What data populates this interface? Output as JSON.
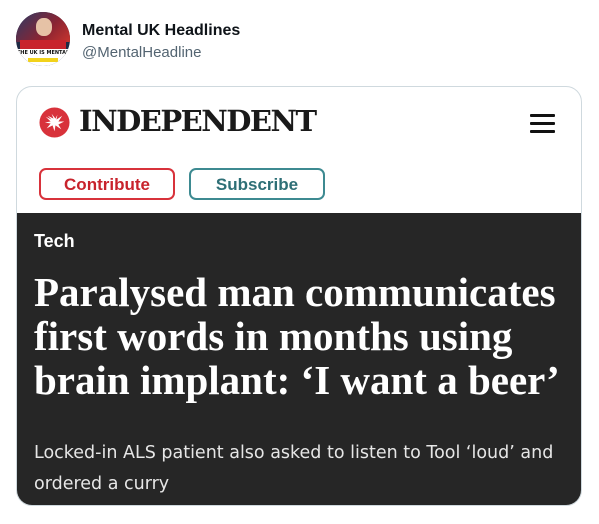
{
  "tweet": {
    "display_name": "Mental UK Headlines",
    "handle": "@MentalHeadline",
    "avatar_caption": "THE UK IS MENTAL"
  },
  "site": {
    "name": "INDEPENDENT",
    "logo_icon": "eagle-icon",
    "menu_icon": "hamburger-menu-icon",
    "brand_color": "#c8232c"
  },
  "actions": {
    "contribute_label": "Contribute",
    "subscribe_label": "Subscribe",
    "contribute_color": "#d8323b",
    "subscribe_color": "#3d8a91"
  },
  "article": {
    "category": "Tech",
    "headline": "Paralysed man communicates first words in months using brain implant: ‘I want a beer’",
    "subheadline": "Locked-in ALS patient also asked to listen to Tool ‘loud’ and ordered a curry",
    "background_color": "#262626"
  }
}
